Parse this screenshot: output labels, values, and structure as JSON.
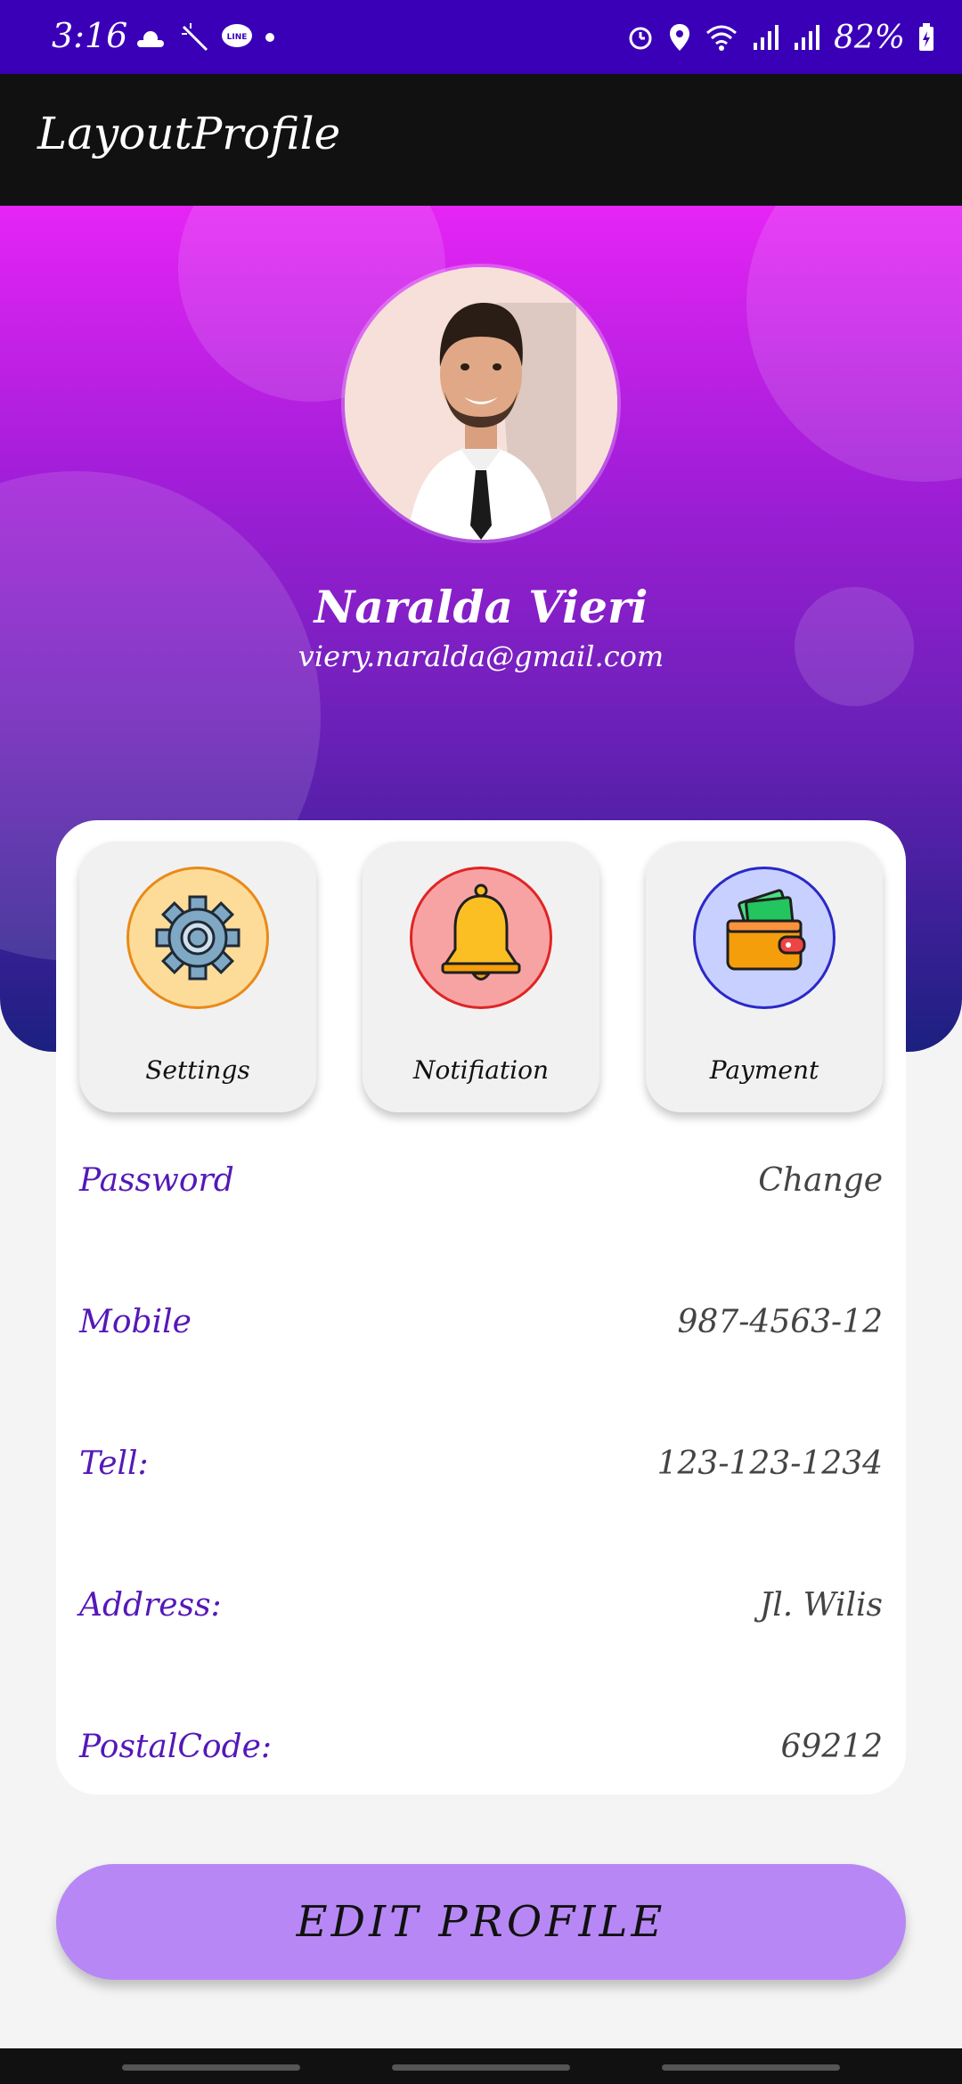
{
  "status_bar": {
    "time": "3:16",
    "battery": "82%",
    "left_icons": [
      "weather-icon",
      "magic-wand-icon",
      "line-app-icon",
      "dot-icon"
    ],
    "right_icons": [
      "alarm-icon",
      "location-icon",
      "wifi-icon",
      "signal-icon",
      "signal-icon",
      "battery-icon"
    ],
    "bg_color": "#3a00b8"
  },
  "app_bar": {
    "title": "LayoutProfile",
    "bg_color": "#111111"
  },
  "profile": {
    "name": "Naralda Vieri",
    "email": "viery.naralda@gmail.com"
  },
  "tiles": [
    {
      "label": "Settings",
      "icon": "gear-icon",
      "circle_color": "#fcdc98",
      "border_color": "#e88a1a"
    },
    {
      "label": "Notifiation",
      "icon": "bell-icon",
      "circle_color": "#f8a3a3",
      "border_color": "#e02424"
    },
    {
      "label": "Payment",
      "icon": "wallet-icon",
      "circle_color": "#c8d0ff",
      "border_color": "#2a28c8"
    }
  ],
  "info": [
    {
      "label": "Password",
      "value": "Change"
    },
    {
      "label": "Mobile",
      "value": "987-4563-12"
    },
    {
      "label": "Tell:",
      "value": "123-123-1234"
    },
    {
      "label": "Address:",
      "value": "Jl. Wilis"
    },
    {
      "label": "PostalCode:",
      "value": "69212"
    }
  ],
  "button": {
    "label": "EDIT PROFILE",
    "color": "#b788f5"
  },
  "colors": {
    "accent": "#5418b8",
    "gradient_top": "#e624f5",
    "gradient_bottom": "#1b2080"
  }
}
